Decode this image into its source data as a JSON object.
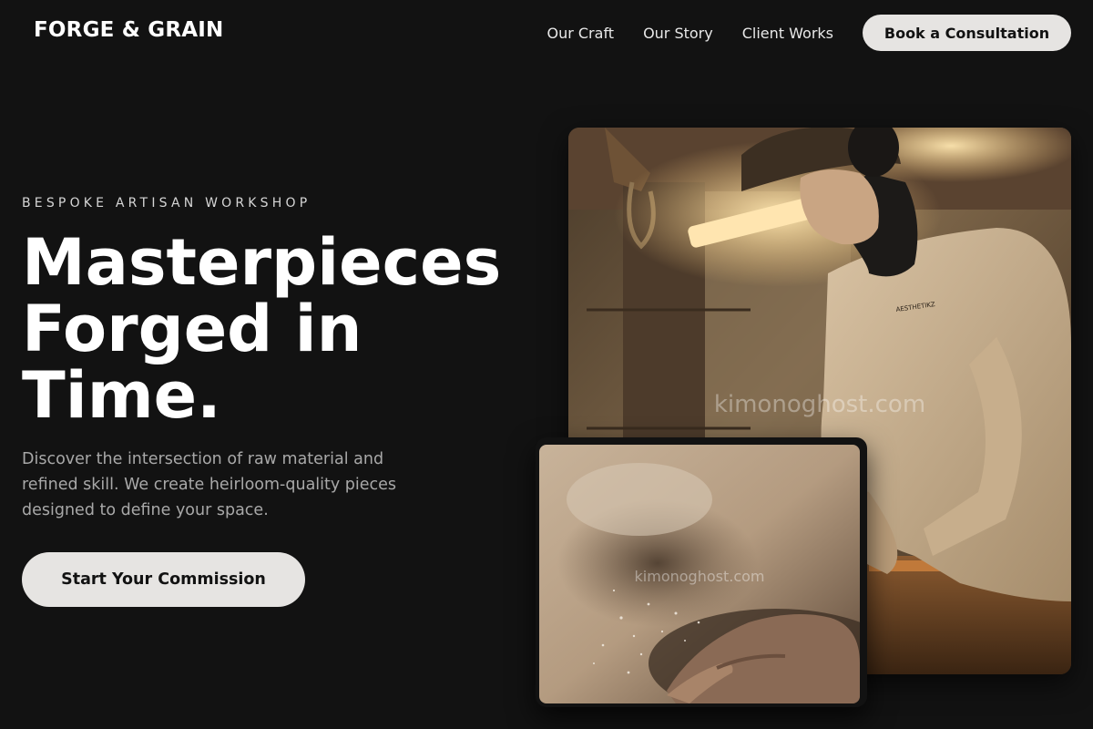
{
  "brand": {
    "name": "FORGE & GRAIN"
  },
  "nav": {
    "links": [
      "Our Craft",
      "Our Story",
      "Client Works"
    ],
    "cta_label": "Book a Consultation"
  },
  "hero": {
    "eyebrow": "BESPOKE ARTISAN WORKSHOP",
    "headline_lines": [
      "Masterpieces",
      "Forged in",
      "Time."
    ],
    "subcopy": "Discover the intersection of raw material and refined skill. We create heirloom-quality pieces designed to define your space.",
    "cta_label": "Start Your Commission"
  },
  "images": {
    "main_watermark": "kimonoghost.com",
    "secondary_watermark": "kimonoghost.com",
    "sweatshirt_print": "AESTHETIKZ"
  },
  "colors": {
    "background": "#121212",
    "button_bg": "#e6e4e2",
    "button_text": "#121212",
    "subcopy": "#a8a8a8"
  }
}
